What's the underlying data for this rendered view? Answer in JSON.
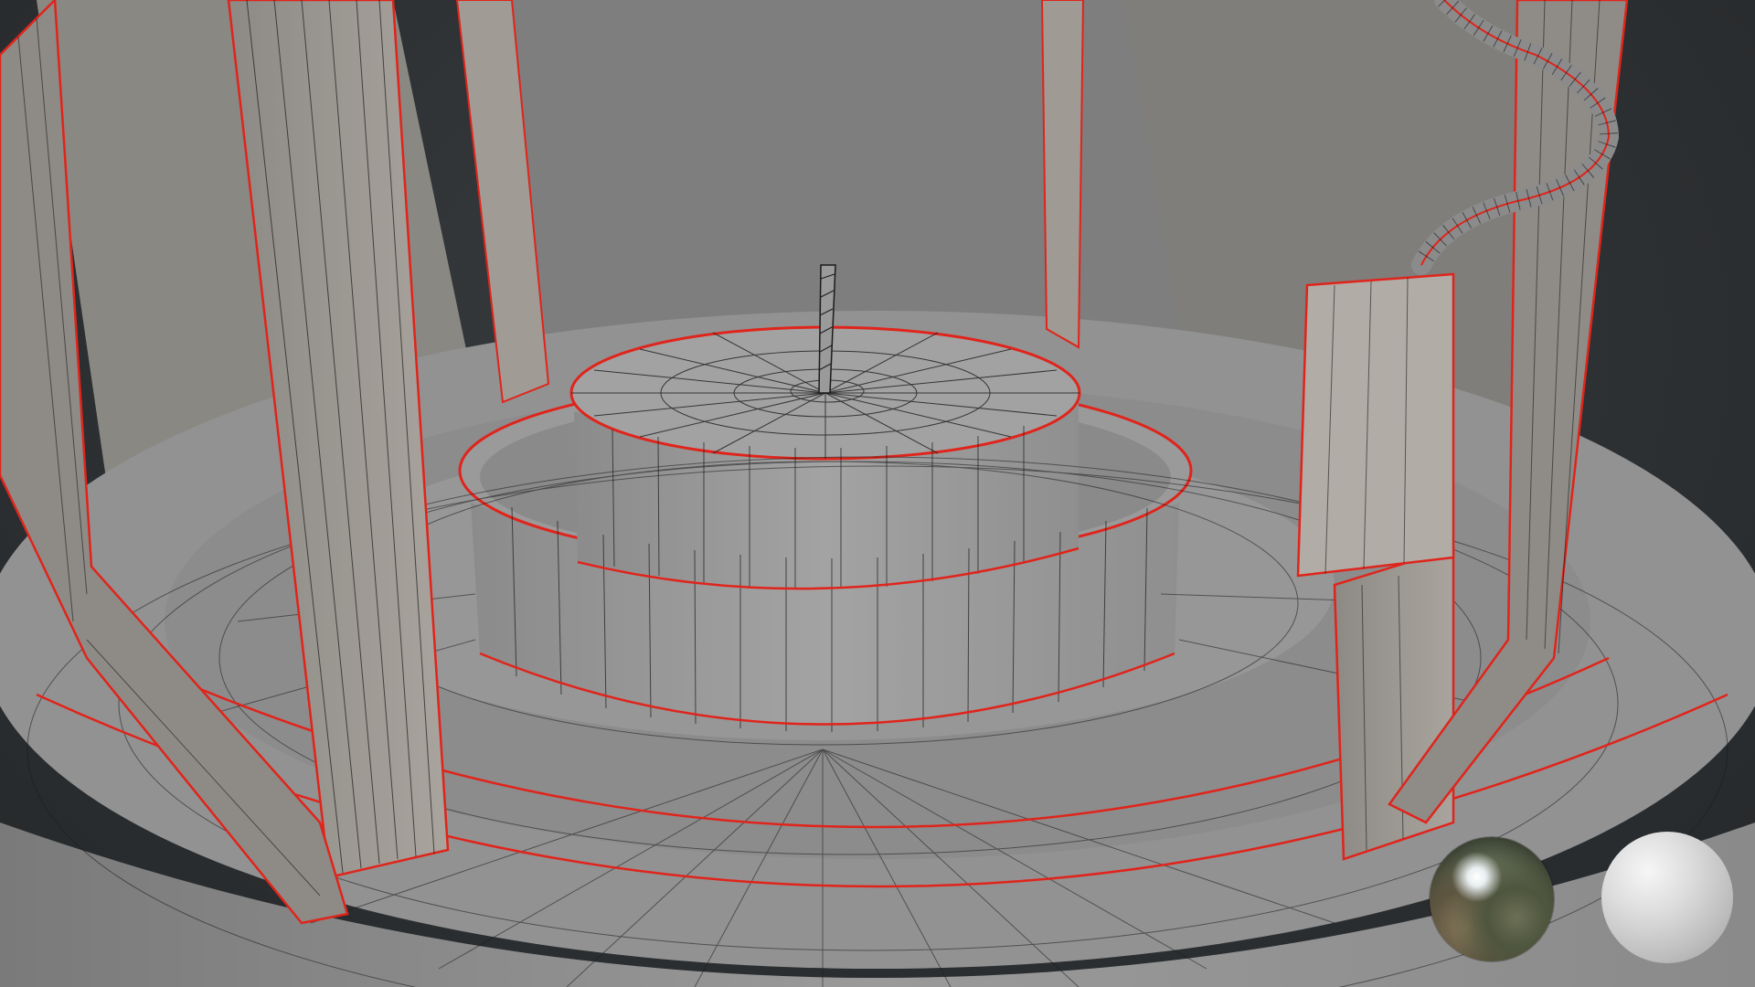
{
  "viewport": {
    "background_color": "#2f3234",
    "wire_color": "#1b1b1b",
    "outline_color": "#e0241b",
    "surface_color": "#8f8f8f",
    "inner_wall_color": "#9b968f",
    "back_wall_color": "#7e7e7e"
  },
  "material_preview": {
    "spheres": [
      {
        "name": "hdri-chrome-sphere",
        "style": "reflective"
      },
      {
        "name": "white-diffuse-sphere",
        "style": "diffuse"
      }
    ]
  }
}
